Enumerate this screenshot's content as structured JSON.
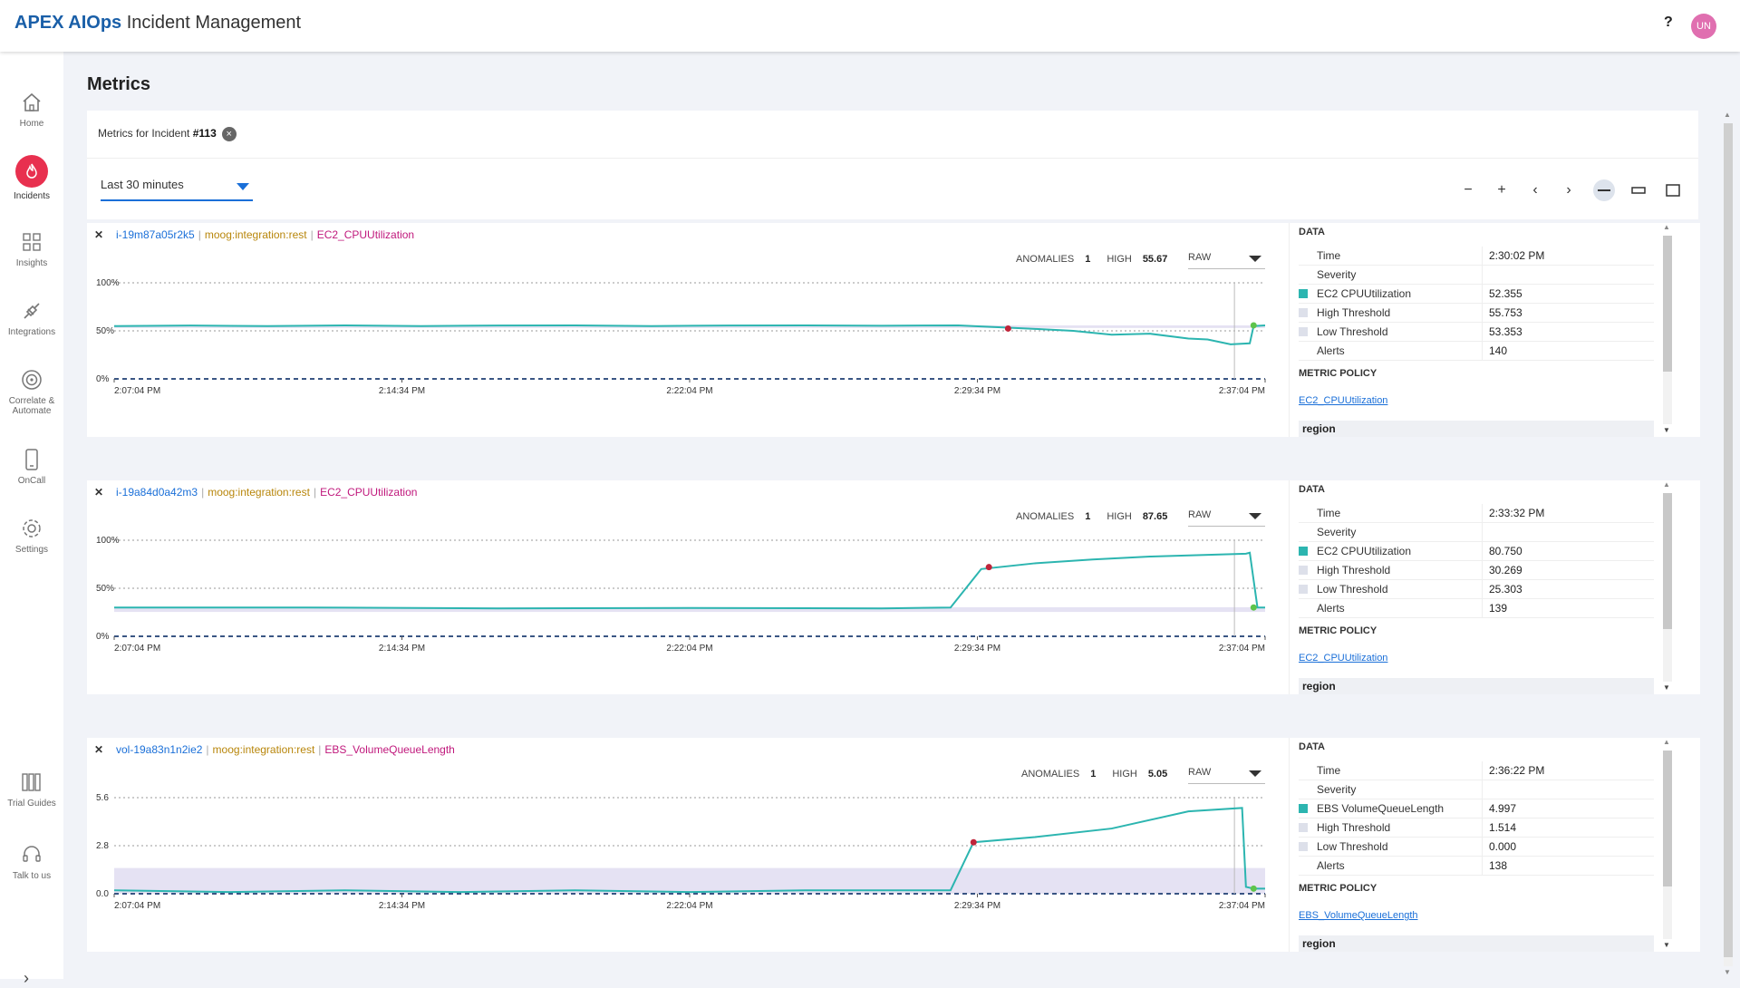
{
  "app": {
    "brand": "APEX AIOps",
    "title": "Incident Management",
    "help": "?",
    "user_initials": "UN"
  },
  "sidebar": {
    "items": [
      {
        "label": "Home",
        "icon": "home-icon"
      },
      {
        "label": "Incidents",
        "icon": "flame-icon",
        "active": true
      },
      {
        "label": "Insights",
        "icon": "grid-icon"
      },
      {
        "label": "Integrations",
        "icon": "plug-icon"
      },
      {
        "label": "Correlate & Automate",
        "icon": "target-icon"
      },
      {
        "label": "OnCall",
        "icon": "phone-icon"
      },
      {
        "label": "Settings",
        "icon": "gear-icon"
      },
      {
        "label": "Trial Guides",
        "icon": "book-icon"
      },
      {
        "label": "Talk to us",
        "icon": "headset-icon"
      }
    ],
    "expand": "›"
  },
  "page": {
    "title": "Metrics",
    "incident_prefix": "Metrics for Incident ",
    "incident_id": "#113",
    "time_range": "Last 30 minutes"
  },
  "toolbar": {
    "zoom_out": "−",
    "zoom_in": "+",
    "prev": "‹",
    "next": "›"
  },
  "panels": [
    {
      "host": "i-19m87a05r2k5",
      "source": "moog:integration:rest",
      "metric": "EC2_CPUUtilization",
      "anomalies_label": "ANOMALIES",
      "anomalies": "1",
      "high_label": "HIGH",
      "high": "55.67",
      "mode": "RAW",
      "data_heading": "DATA",
      "rows": [
        {
          "k": "Time",
          "v": "2:30:02 PM"
        },
        {
          "k": "Severity",
          "v": ""
        },
        {
          "k": "EC2 CPUUtilization",
          "v": "52.355"
        },
        {
          "k": "High Threshold",
          "v": "55.753"
        },
        {
          "k": "Low Threshold",
          "v": "53.353"
        },
        {
          "k": "Alerts",
          "v": "140"
        }
      ],
      "policy_heading": "METRIC POLICY",
      "policy_link": "EC2_CPUUtilization",
      "region": "region"
    },
    {
      "host": "i-19a84d0a42m3",
      "source": "moog:integration:rest",
      "metric": "EC2_CPUUtilization",
      "anomalies_label": "ANOMALIES",
      "anomalies": "1",
      "high_label": "HIGH",
      "high": "87.65",
      "mode": "RAW",
      "data_heading": "DATA",
      "rows": [
        {
          "k": "Time",
          "v": "2:33:32 PM"
        },
        {
          "k": "Severity",
          "v": ""
        },
        {
          "k": "EC2 CPUUtilization",
          "v": "80.750"
        },
        {
          "k": "High Threshold",
          "v": "30.269"
        },
        {
          "k": "Low Threshold",
          "v": "25.303"
        },
        {
          "k": "Alerts",
          "v": "139"
        }
      ],
      "policy_heading": "METRIC POLICY",
      "policy_link": "EC2_CPUUtilization",
      "region": "region"
    },
    {
      "host": "vol-19a83n1n2ie2",
      "source": "moog:integration:rest",
      "metric": "EBS_VolumeQueueLength",
      "anomalies_label": "ANOMALIES",
      "anomalies": "1",
      "high_label": "HIGH",
      "high": "5.05",
      "mode": "RAW",
      "data_heading": "DATA",
      "rows": [
        {
          "k": "Time",
          "v": "2:36:22 PM"
        },
        {
          "k": "Severity",
          "v": ""
        },
        {
          "k": "EBS VolumeQueueLength",
          "v": "4.997"
        },
        {
          "k": "High Threshold",
          "v": "1.514"
        },
        {
          "k": "Low Threshold",
          "v": "0.000"
        },
        {
          "k": "Alerts",
          "v": "138"
        }
      ],
      "policy_heading": "METRIC POLICY",
      "policy_link": "EBS_VolumeQueueLength",
      "region": "region"
    }
  ],
  "colors": {
    "series": "#2cb5b0",
    "anomaly": "#c0243a",
    "current": "#5ec44b",
    "band": "#dcd8ef",
    "brand": "#1a5fa8",
    "link": "#1a6fd8"
  },
  "chart_data": [
    {
      "type": "line",
      "x_ticks": [
        "2:07:04 PM",
        "2:14:34 PM",
        "2:22:04 PM",
        "2:29:34 PM",
        "2:37:04 PM"
      ],
      "y_ticks": [
        "100%",
        "50%",
        "0%"
      ],
      "ylim": [
        0,
        100
      ],
      "xlim": [
        0,
        30
      ],
      "grid": true,
      "x": [
        0,
        2,
        4,
        6,
        8,
        10,
        12,
        14,
        16,
        18,
        20,
        22,
        23.5,
        24,
        25,
        26,
        27,
        28,
        28.5,
        29.1,
        29.6,
        29.7,
        30
      ],
      "series": [
        {
          "values": [
            55,
            55.5,
            55,
            55.7,
            55,
            55.5,
            55.7,
            55,
            55.5,
            55.7,
            55.3,
            55.7,
            53,
            52,
            50,
            46,
            47,
            42,
            41,
            36,
            37,
            55,
            55.7
          ]
        }
      ],
      "band": {
        "low": [
          53,
          53,
          53,
          53,
          53,
          53,
          53,
          53,
          53,
          53,
          53,
          53,
          53,
          53,
          53,
          53,
          53,
          53,
          53,
          53,
          53,
          53,
          53
        ],
        "high": [
          55.7,
          55.7,
          55.7,
          55.7,
          55.7,
          55.7,
          55.7,
          55.7,
          55.7,
          55.7,
          55.7,
          55.7,
          55.7,
          55.7,
          55.7,
          55.7,
          55.7,
          55.7,
          55.7,
          55.7,
          55.7,
          55.7,
          55.7
        ]
      },
      "anomaly_point": {
        "x": 23.3,
        "y": 52.4
      },
      "current_point": {
        "x": 29.7,
        "y": 55.7
      },
      "cursor_x": 29.2
    },
    {
      "type": "line",
      "x_ticks": [
        "2:07:04 PM",
        "2:14:34 PM",
        "2:22:04 PM",
        "2:29:34 PM",
        "2:37:04 PM"
      ],
      "y_ticks": [
        "100%",
        "50%",
        "0%"
      ],
      "ylim": [
        0,
        100
      ],
      "xlim": [
        0,
        30
      ],
      "grid": true,
      "x": [
        0,
        5,
        10,
        15,
        20,
        21.8,
        22.6,
        24,
        25.5,
        27,
        29.5,
        29.6,
        29.8,
        30
      ],
      "series": [
        {
          "values": [
            30,
            30,
            29,
            29.5,
            29,
            30,
            70,
            76,
            80,
            83,
            86,
            87,
            30,
            30
          ]
        }
      ],
      "band": {
        "low": [
          25.3,
          25.3,
          25.3,
          25.3,
          25.3,
          25.3,
          25.3,
          25.3,
          25.3,
          25.3,
          25.3,
          25.3,
          25.3,
          25.3
        ],
        "high": [
          30.3,
          30.3,
          30.3,
          30.3,
          30.3,
          30.3,
          30.3,
          30.3,
          30.3,
          30.3,
          30.3,
          30.3,
          30.3,
          30.3
        ]
      },
      "anomaly_point": {
        "x": 22.8,
        "y": 72
      },
      "current_point": {
        "x": 29.7,
        "y": 30
      },
      "cursor_x": 29.2
    },
    {
      "type": "line",
      "x_ticks": [
        "2:07:04 PM",
        "2:14:34 PM",
        "2:22:04 PM",
        "2:29:34 PM",
        "2:37:04 PM"
      ],
      "y_ticks": [
        "5.6",
        "2.8",
        "0.0"
      ],
      "ylim": [
        0,
        5.6
      ],
      "xlim": [
        0,
        30
      ],
      "grid": true,
      "x": [
        0,
        3,
        6,
        9,
        12,
        15,
        18,
        21,
        21.8,
        22.4,
        24,
        26,
        28,
        29.4,
        29.5,
        29.7,
        30
      ],
      "series": [
        {
          "values": [
            0.2,
            0.1,
            0.2,
            0.1,
            0.2,
            0.1,
            0.2,
            0.2,
            0.2,
            3.0,
            3.3,
            3.8,
            4.8,
            5.0,
            0.4,
            0.3,
            0.3
          ]
        }
      ],
      "band": {
        "low": [
          0,
          0,
          0,
          0,
          0,
          0,
          0,
          0,
          0,
          0,
          0,
          0,
          0,
          0,
          0,
          0,
          0
        ],
        "high": [
          1.5,
          1.5,
          1.5,
          1.5,
          1.5,
          1.5,
          1.5,
          1.5,
          1.5,
          1.5,
          1.5,
          1.5,
          1.5,
          1.5,
          1.5,
          1.5,
          1.5
        ]
      },
      "anomaly_point": {
        "x": 22.4,
        "y": 3.0
      },
      "current_point": {
        "x": 29.7,
        "y": 0.3
      },
      "cursor_x": 29.2
    }
  ]
}
